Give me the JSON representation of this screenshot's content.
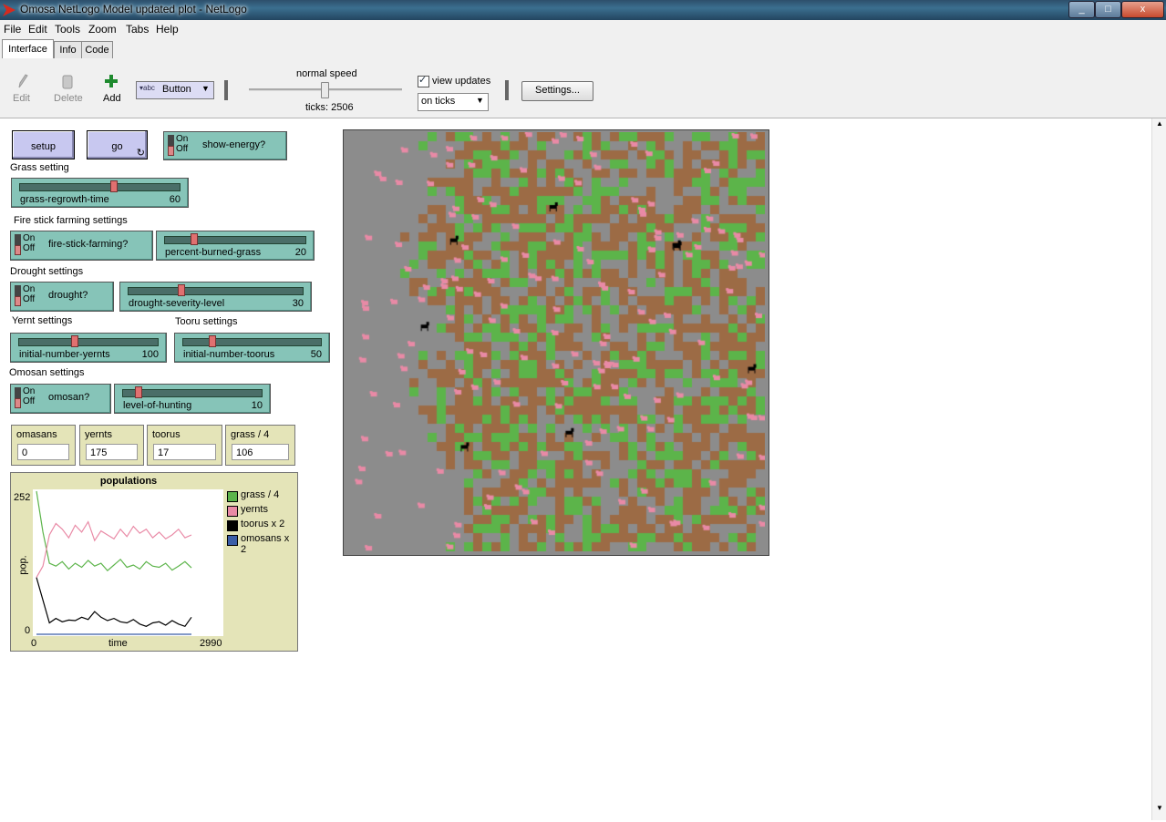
{
  "window": {
    "title": "Omosa NetLogo Model updated plot - NetLogo",
    "minimize": "_",
    "maximize": "□",
    "close": "x"
  },
  "menu": [
    "File",
    "Edit",
    "Tools",
    "Zoom",
    "Tabs",
    "Help"
  ],
  "tabs": [
    "Interface",
    "Info",
    "Code"
  ],
  "toolbar": {
    "edit": "Edit",
    "delete": "Delete",
    "add": "Add",
    "widget_type": "Button",
    "speed_label": "normal speed",
    "ticks": "ticks: 2506",
    "view_updates": "view updates",
    "update_mode": "on ticks",
    "settings": "Settings..."
  },
  "buttons": {
    "setup": "setup",
    "go": "go"
  },
  "switch_text": {
    "on": "On",
    "off": "Off"
  },
  "switches": {
    "show_energy": "show-energy?",
    "fire_stick": "fire-stick-farming?",
    "drought": "drought?",
    "omosan": "omosan?"
  },
  "notes": {
    "grass": "Grass setting",
    "fire": "Fire stick farming settings",
    "drought": "Drought settings",
    "yernt": "Yernt settings",
    "tooru": "Tooru settings",
    "omosan": "Omosan settings"
  },
  "sliders": {
    "grass_regrowth": {
      "label": "grass-regrowth-time",
      "value": "60",
      "fraction": 0.6
    },
    "percent_burned": {
      "label": "percent-burned-grass",
      "value": "20",
      "fraction": 0.2
    },
    "drought_severity": {
      "label": "drought-severity-level",
      "value": "30",
      "fraction": 0.3
    },
    "initial_yernts": {
      "label": "initial-number-yernts",
      "value": "100",
      "fraction": 0.4
    },
    "initial_toorus": {
      "label": "initial-number-toorus",
      "value": "50",
      "fraction": 0.2
    },
    "hunting": {
      "label": "level-of-hunting",
      "value": "10",
      "fraction": 0.1
    }
  },
  "monitors": [
    {
      "label": "omasans",
      "value": "0"
    },
    {
      "label": "yernts",
      "value": "175"
    },
    {
      "label": "toorus",
      "value": "17"
    },
    {
      "label": "grass / 4",
      "value": "106"
    }
  ],
  "colors": {
    "grass": "#5cb44a",
    "dirt": "#9c6b45",
    "empty": "#8c8c8c",
    "yernt": "#e98aa6",
    "tooru": "#000000",
    "omosan": "#3b5ea8",
    "button": "#c8c8f0",
    "widget": "#86c4b8",
    "monitor": "#e4e4b8"
  },
  "chart_data": {
    "type": "line",
    "title": "populations",
    "xlabel": "time",
    "ylabel": "pop.",
    "xlim": [
      0,
      2990
    ],
    "ylim": [
      0,
      252
    ],
    "x_tick_labels": [
      "0",
      "2990"
    ],
    "y_tick_labels": [
      "0",
      "252"
    ],
    "legend_position": "right",
    "series": [
      {
        "name": "grass / 4",
        "color": "#5cb44a",
        "values": [
          252,
          180,
          125,
          120,
          128,
          115,
          125,
          118,
          130,
          120,
          125,
          112,
          122,
          132,
          118,
          122,
          115,
          128,
          120,
          118,
          125,
          113,
          120,
          128,
          117
        ]
      },
      {
        "name": "yernts",
        "color": "#e98aa6",
        "values": [
          100,
          120,
          175,
          195,
          185,
          170,
          192,
          180,
          198,
          165,
          182,
          175,
          168,
          185,
          172,
          190,
          178,
          185,
          170,
          180,
          168,
          175,
          185,
          170,
          175
        ]
      },
      {
        "name": "toorus x 2",
        "color": "#000000",
        "values": [
          100,
          60,
          20,
          28,
          22,
          25,
          24,
          30,
          26,
          40,
          30,
          24,
          28,
          22,
          20,
          26,
          18,
          14,
          20,
          22,
          16,
          24,
          18,
          14,
          30
        ]
      },
      {
        "name": "omosans x 2",
        "color": "#3b5ea8",
        "values": [
          0,
          0,
          0,
          0,
          0,
          0,
          0,
          0,
          0,
          0,
          0,
          0,
          0,
          0,
          0,
          0,
          0,
          0,
          0,
          0,
          0,
          0,
          0,
          0,
          0
        ]
      }
    ]
  },
  "world": {
    "patches": 46,
    "seed": 7,
    "yernts": 175,
    "toorus": 8
  }
}
